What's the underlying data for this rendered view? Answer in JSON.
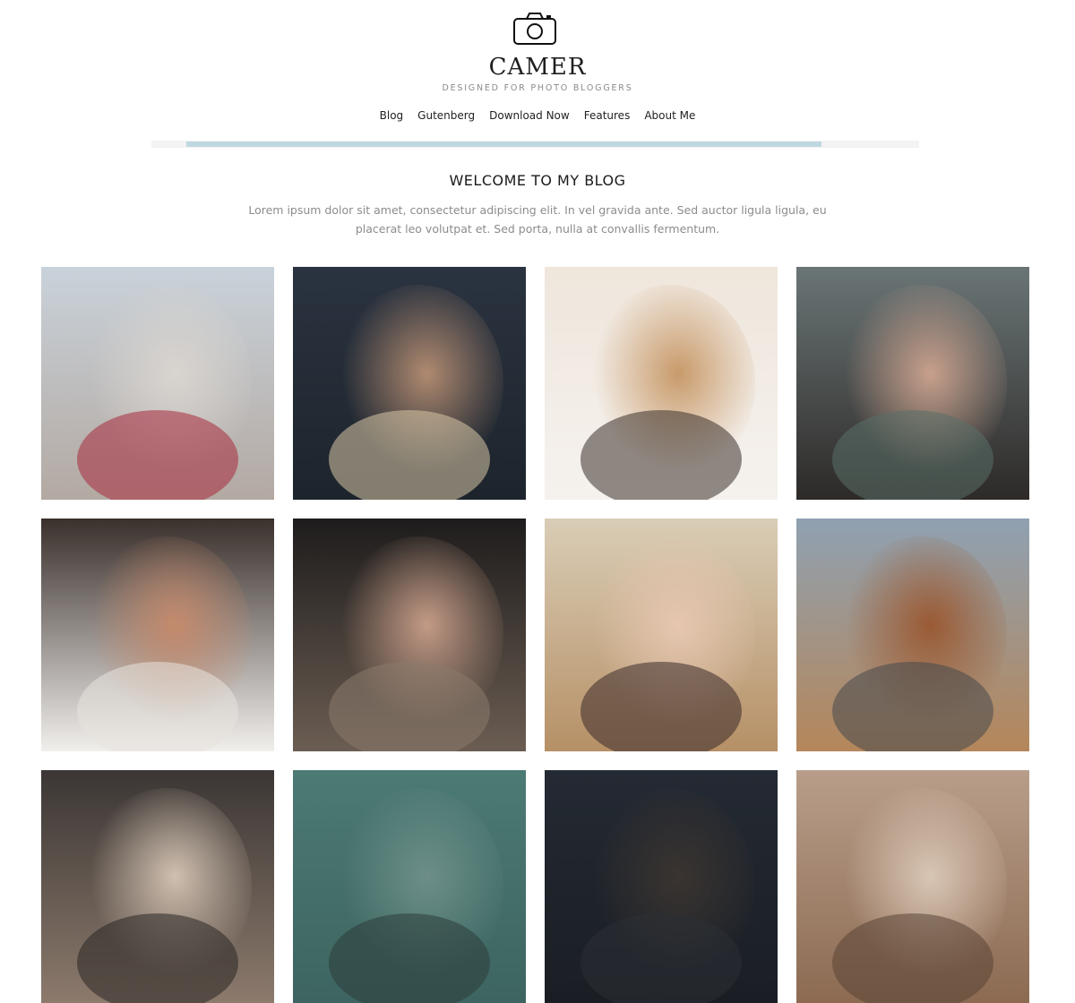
{
  "site": {
    "title": "CAMER",
    "tagline": "DESIGNED FOR PHOTO BLOGGERS",
    "logo_icon": "camera-icon"
  },
  "nav": {
    "items": [
      "Blog",
      "Gutenberg",
      "Download Now",
      "Features",
      "About Me"
    ]
  },
  "progress": {
    "fraction": 0.91
  },
  "welcome": {
    "heading": "WELCOME TO MY BLOG",
    "text": "Lorem ipsum dolor sit amet, consectetur adipiscing elit. In vel gravida ante. Sed auctor ligula ligula, eu placerat leo volutpat et. Sed porta, nulla at convallis fermentum."
  },
  "gallery": {
    "photos": [
      {
        "subject": "woman-in-desert-photo",
        "palette": [
          "#c9d2da",
          "#b3a9a2",
          "#d9d4cf",
          "#a72a3c"
        ]
      },
      {
        "subject": "mother-and-child-photo",
        "palette": [
          "#2a3340",
          "#1d242c",
          "#b08a70",
          "#d9c8a8"
        ]
      },
      {
        "subject": "sleeping-cat-photo",
        "palette": [
          "#efe6dc",
          "#f5f2ee",
          "#c89a6a",
          "#3b3029"
        ]
      },
      {
        "subject": "couple-embrace-photo",
        "palette": [
          "#6a7576",
          "#2d2a28",
          "#c8a08c",
          "#5a7068"
        ]
      },
      {
        "subject": "family-portrait-photo",
        "palette": [
          "#3a302c",
          "#f1efec",
          "#c48a6c",
          "#e8e4df"
        ]
      },
      {
        "subject": "hooded-woman-photo",
        "palette": [
          "#1e1c1c",
          "#6b5d52",
          "#c49b86",
          "#8a7a6c"
        ]
      },
      {
        "subject": "mother-daughter-photo",
        "palette": [
          "#d9cdb6",
          "#b69066",
          "#e6c6b0",
          "#3a2a2a"
        ]
      },
      {
        "subject": "dog-in-suit-photo",
        "palette": [
          "#8fa1b1",
          "#b5865a",
          "#9a5a34",
          "#45484c"
        ]
      },
      {
        "subject": "elderly-man-photo",
        "palette": [
          "#3b3634",
          "#8c7a6c",
          "#d0c0b0",
          "#2a2624"
        ]
      },
      {
        "subject": "teal-portrait-photo",
        "palette": [
          "#4c7a74",
          "#3d6460",
          "#6d8e88",
          "#2c3c3a"
        ]
      },
      {
        "subject": "dark-portrait-photo",
        "palette": [
          "#242a33",
          "#1a1e24",
          "#3a3430",
          "#2c2f34"
        ]
      },
      {
        "subject": "fur-closeup-photo",
        "palette": [
          "#b89e8a",
          "#8c6a52",
          "#d8c6b4",
          "#5a4434"
        ]
      }
    ]
  }
}
